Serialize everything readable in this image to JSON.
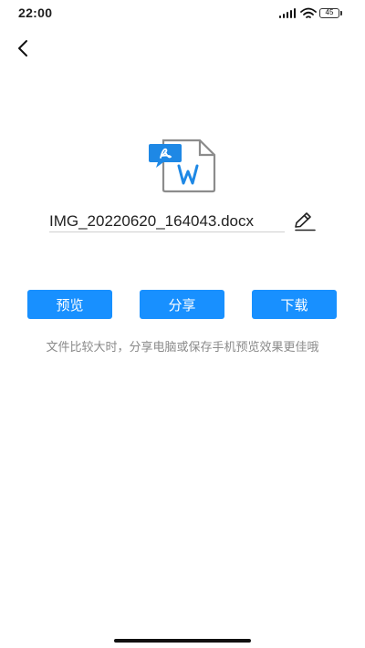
{
  "status_bar": {
    "time": "22:00",
    "battery": "45",
    "icons": [
      "signal-icon",
      "wifi-icon",
      "battery-icon"
    ]
  },
  "nav": {
    "back_icon": "back-arrow-icon"
  },
  "file": {
    "icon": "pdf-to-word-file-icon",
    "name": "IMG_20220620_164043.docx",
    "edit_icon": "edit-pencil-icon"
  },
  "actions": {
    "preview_label": "预览",
    "share_label": "分享",
    "download_label": "下载"
  },
  "tip": "文件比较大时，分享电脑或保存手机预览效果更佳哦",
  "colors": {
    "accent": "#1890ff",
    "icon_blue": "#1e88e5",
    "tip_text": "#8a8a8a"
  }
}
